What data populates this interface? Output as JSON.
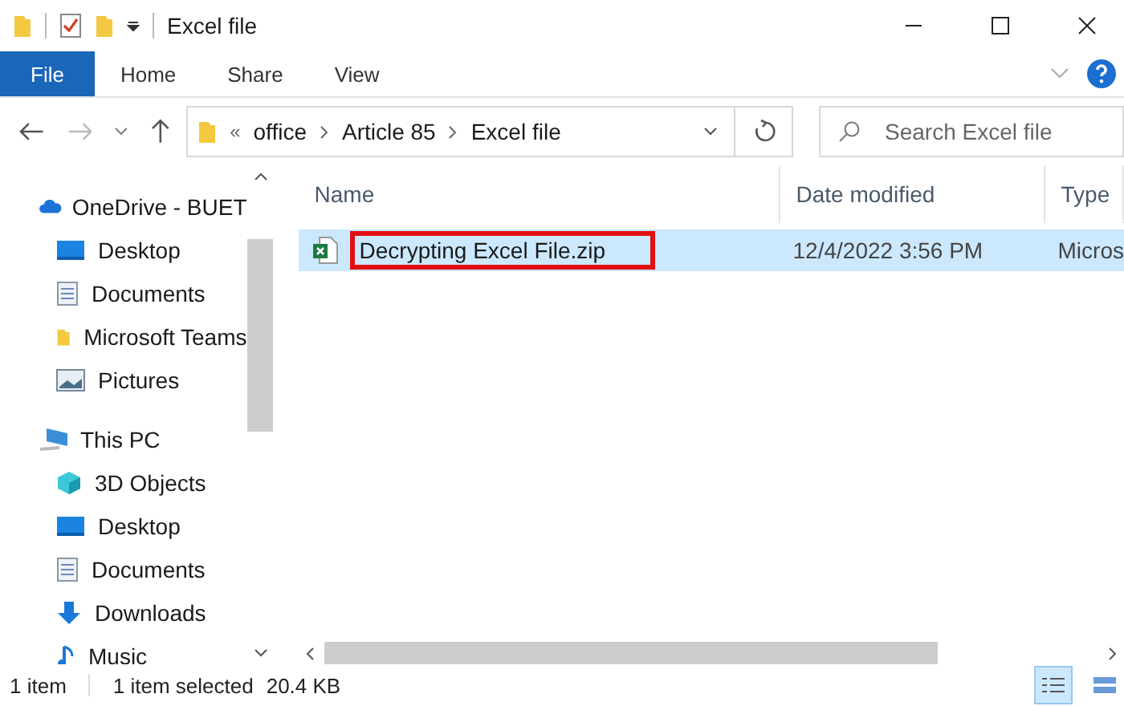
{
  "window": {
    "title": "Excel file"
  },
  "ribbon_tabs": [
    {
      "label": "File",
      "selected": true
    },
    {
      "label": "Home",
      "selected": false
    },
    {
      "label": "Share",
      "selected": false
    },
    {
      "label": "View",
      "selected": false
    }
  ],
  "address_bar": {
    "overflow": "«",
    "path": [
      "office",
      "Article 85",
      "Excel file"
    ]
  },
  "search": {
    "placeholder": "Search Excel file"
  },
  "sidebar": {
    "items": [
      {
        "label": "OneDrive - BUET",
        "kind": "cloud",
        "children": [
          {
            "label": "Desktop",
            "kind": "desktop"
          },
          {
            "label": "Documents",
            "kind": "documents"
          },
          {
            "label": "Microsoft Teams",
            "kind": "folder"
          },
          {
            "label": "Pictures",
            "kind": "pictures"
          }
        ]
      },
      {
        "label": "This PC",
        "kind": "pc",
        "children": [
          {
            "label": "3D Objects",
            "kind": "cube"
          },
          {
            "label": "Desktop",
            "kind": "desktop"
          },
          {
            "label": "Documents",
            "kind": "documents"
          },
          {
            "label": "Downloads",
            "kind": "download"
          },
          {
            "label": "Music",
            "kind": "music"
          }
        ]
      }
    ]
  },
  "table": {
    "columns": [
      "Name",
      "Date modified",
      "Type"
    ],
    "rows": [
      {
        "name": "Decrypting Excel File.zip",
        "date": "12/4/2022 3:56 PM",
        "type": "Micros",
        "selected": true,
        "highlighted": true
      }
    ]
  },
  "status_bar": {
    "items": "1 item",
    "selected": "1 item selected",
    "size": "20.4 KB"
  },
  "view_buttons": [
    {
      "kind": "details",
      "selected": true
    },
    {
      "kind": "tiles",
      "selected": false
    }
  ]
}
